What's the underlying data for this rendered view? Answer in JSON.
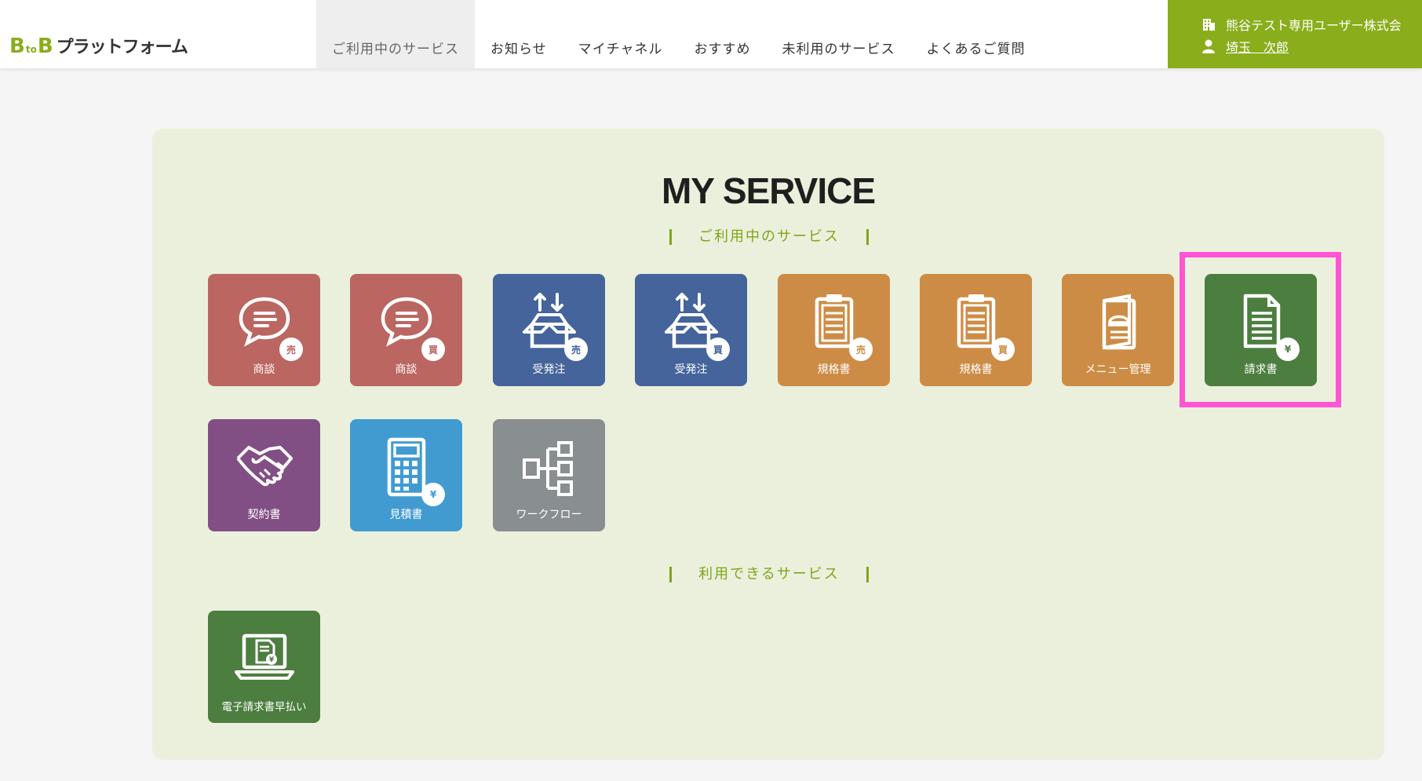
{
  "header": {
    "logo": {
      "b1": "B",
      "to": "to",
      "b2": "B",
      "rest": "プラットフォーム"
    },
    "nav": [
      {
        "label": "ご利用中のサービス",
        "active": true
      },
      {
        "label": "お知らせ"
      },
      {
        "label": "マイチャネル"
      },
      {
        "label": "おすすめ"
      },
      {
        "label": "未利用のサービス"
      },
      {
        "label": "よくあるご質問"
      }
    ],
    "account": {
      "company": "熊谷テスト専用ユーザー株式会",
      "user": "埼玉　次郎",
      "company_icon": "building-icon",
      "user_icon": "user-icon"
    }
  },
  "main": {
    "title": "MY SERVICE",
    "section_in_use": "ご利用中のサービス",
    "section_available": "利用できるサービス",
    "tiles_in_use": [
      {
        "label": "商談",
        "badge": "売",
        "color": "#bb6661",
        "icon": "chat-icon"
      },
      {
        "label": "商談",
        "badge": "買",
        "color": "#bb6661",
        "icon": "chat-icon"
      },
      {
        "label": "受発注",
        "badge": "売",
        "color": "#44649b",
        "icon": "box-arrows-icon"
      },
      {
        "label": "受発注",
        "badge": "買",
        "color": "#44649b",
        "icon": "box-arrows-icon"
      },
      {
        "label": "規格書",
        "badge": "売",
        "color": "#cd8c45",
        "icon": "clipboard-icon"
      },
      {
        "label": "規格書",
        "badge": "買",
        "color": "#cd8c45",
        "icon": "clipboard-icon"
      },
      {
        "label": "メニュー管理",
        "badge": "",
        "color": "#cd8c45",
        "icon": "menu-book-icon"
      },
      {
        "label": "請求書",
        "badge": "¥",
        "color": "#4c7e3f",
        "icon": "invoice-icon",
        "highlighted": true
      },
      {
        "label": "契約書",
        "badge": "",
        "color": "#824f84",
        "icon": "handshake-icon"
      },
      {
        "label": "見積書",
        "badge": "¥",
        "color": "#419bd1",
        "icon": "calculator-icon"
      },
      {
        "label": "ワークフロー",
        "badge": "",
        "color": "#898e90",
        "icon": "workflow-icon"
      }
    ],
    "tiles_available": [
      {
        "label": "電子請求書早払い",
        "badge": "",
        "color": "#4c7e3f",
        "icon": "laptop-invoice-icon"
      }
    ],
    "badge_colors": {
      "sell": "#bb6661",
      "buy": "#bb6661",
      "yen": "#4c7e3f"
    },
    "highlight_color": "#ff55d4"
  }
}
